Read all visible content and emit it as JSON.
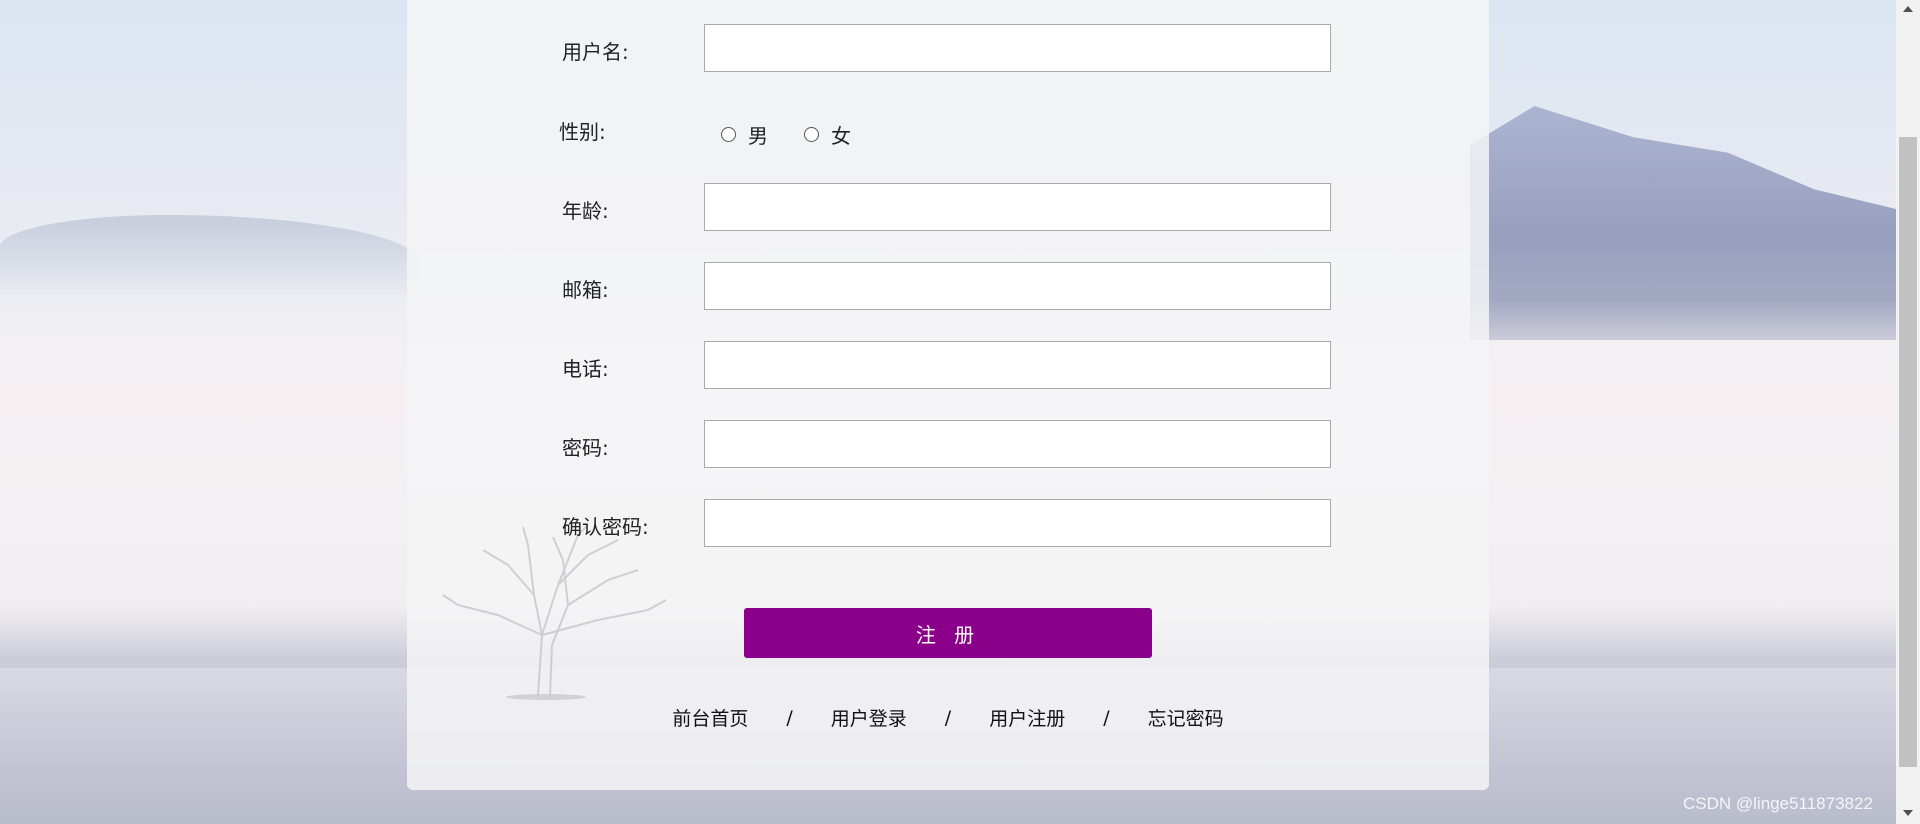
{
  "form": {
    "username_label": "用户名:",
    "gender_label": "性别:",
    "gender_options": [
      "男",
      "女"
    ],
    "age_label": "年龄:",
    "email_label": "邮箱:",
    "phone_label": "电话:",
    "password_label": "密码:",
    "confirm_password_label": "确认密码:",
    "submit_label": "注 册"
  },
  "nav": {
    "home": "前台首页",
    "login": "用户登录",
    "register": "用户注册",
    "forgot": "忘记密码",
    "separator": "/"
  },
  "watermark": "CSDN @linge511873822",
  "colors": {
    "submit_button": "#8b008b",
    "panel": "#f4f4f6"
  }
}
